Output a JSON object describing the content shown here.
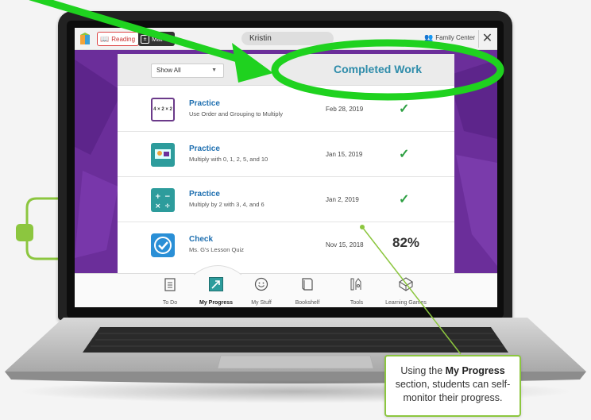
{
  "appbar": {
    "reading_tab": "Reading",
    "math_tab": "Mat",
    "user_name": "Kristin",
    "family_link": "Family Center",
    "close_symbol": "✕"
  },
  "panel": {
    "filter_value": "Show All",
    "title": "Completed Work",
    "rows": [
      {
        "type": "Practice",
        "subtitle": "Use Order and Grouping to Multiply",
        "date": "Feb 28, 2019",
        "status": "✓",
        "icon": "multiply-expression-icon",
        "icon_text": "4 × 2 × 2"
      },
      {
        "type": "Practice",
        "subtitle": "Multiply with 0, 1, 2, 5, and 10",
        "date": "Jan 15, 2019",
        "status": "✓",
        "icon": "illustration-icon"
      },
      {
        "type": "Practice",
        "subtitle": "Multiply by 2 with 3, 4, and 6",
        "date": "Jan 2, 2019",
        "status": "✓",
        "icon": "operations-icon"
      },
      {
        "type": "Check",
        "subtitle": "Ms. G's Lesson Quiz",
        "date": "Nov 15, 2018",
        "status": "82%",
        "icon": "checkmark-icon"
      }
    ]
  },
  "nav": [
    {
      "label": "To Do",
      "icon": "clipboard-icon"
    },
    {
      "label": "My Progress",
      "icon": "progress-arrow-icon",
      "active": true
    },
    {
      "label": "My Stuff",
      "icon": "smiley-icon"
    },
    {
      "label": "Bookshelf",
      "icon": "book-icon"
    },
    {
      "label": "Tools",
      "icon": "tools-icon"
    },
    {
      "label": "Learning Games",
      "icon": "games-icon"
    }
  ],
  "callout": {
    "line1_prefix": "Using the ",
    "line1_bold": "My Progress",
    "line2": "section, students can self-",
    "line3": "monitor their progress."
  },
  "colors": {
    "accent_green": "#8cc63f",
    "highlight_green": "#1fd21f",
    "title_teal": "#2e8caa",
    "link_blue": "#1e6fb0",
    "check_green": "#2ea043",
    "screen_purple": "#6b2e9a"
  }
}
